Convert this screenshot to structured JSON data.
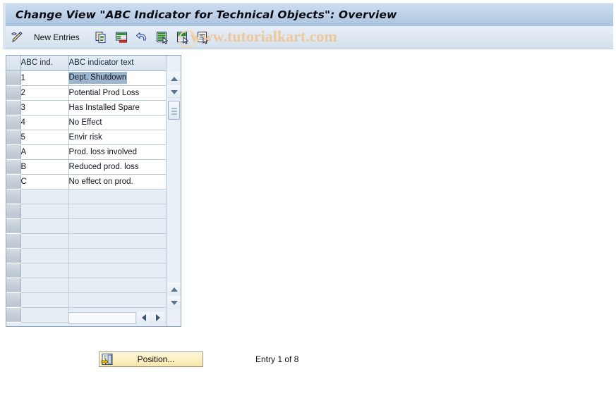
{
  "window": {
    "title": "Change View \"ABC Indicator for Technical Objects\": Overview"
  },
  "toolbar": {
    "display_change_icon": "pencil-icon",
    "new_entries_label": "New Entries",
    "buttons": [
      {
        "name": "copy-as-button",
        "icon": "copy-icon"
      },
      {
        "name": "delete-button",
        "icon": "delete-row-icon"
      },
      {
        "name": "undo-button",
        "icon": "undo-arrow-icon"
      },
      {
        "name": "select-all-button",
        "icon": "select-all-icon"
      },
      {
        "name": "deselect-all-button",
        "icon": "deselect-all-icon"
      },
      {
        "name": "details-button",
        "icon": "details-icon"
      }
    ]
  },
  "watermark": {
    "text": "www.tutorialkart.com",
    "color": "#eec79a"
  },
  "table": {
    "config_icon": "column-config-icon",
    "columns": [
      {
        "key": "abc_ind",
        "label": "ABC ind."
      },
      {
        "key": "abc_text",
        "label": "ABC indicator text"
      }
    ],
    "rows": [
      {
        "abc_ind": "1",
        "abc_text": "Dept. Shutdown",
        "selected": true
      },
      {
        "abc_ind": "2",
        "abc_text": "Potential Prod Loss",
        "selected": false
      },
      {
        "abc_ind": "3",
        "abc_text": "Has Installed Spare",
        "selected": false
      },
      {
        "abc_ind": "4",
        "abc_text": "No Effect",
        "selected": false
      },
      {
        "abc_ind": "5",
        "abc_text": "Envir risk",
        "selected": false
      },
      {
        "abc_ind": "A",
        "abc_text": "Prod. loss involved",
        "selected": false
      },
      {
        "abc_ind": "B",
        "abc_text": "Reduced prod. loss",
        "selected": false
      },
      {
        "abc_ind": "C",
        "abc_text": "No effect on prod.",
        "selected": false
      }
    ],
    "empty_row_count": 9,
    "vertical_scrollbar": {
      "up_arrow": "scroll-up-arrow-icon",
      "down_arrow": "scroll-down-arrow-icon",
      "grip": "scroll-grip-handle"
    },
    "horizontal_scrollbar": {
      "left_arrow": "scroll-left-arrow-icon",
      "right_arrow": "scroll-right-arrow-icon"
    }
  },
  "footer": {
    "position_button_label": "Position...",
    "position_button_icon": "position-icon",
    "entry_status": "Entry 1 of 8"
  },
  "colors": {
    "title_bar": "#b9cde3",
    "toolbar": "#dde7f1",
    "grid_empty_row": "#e6edf5",
    "selection_highlight": "#9db6ce",
    "button_yellow": "#fdf0c2"
  }
}
